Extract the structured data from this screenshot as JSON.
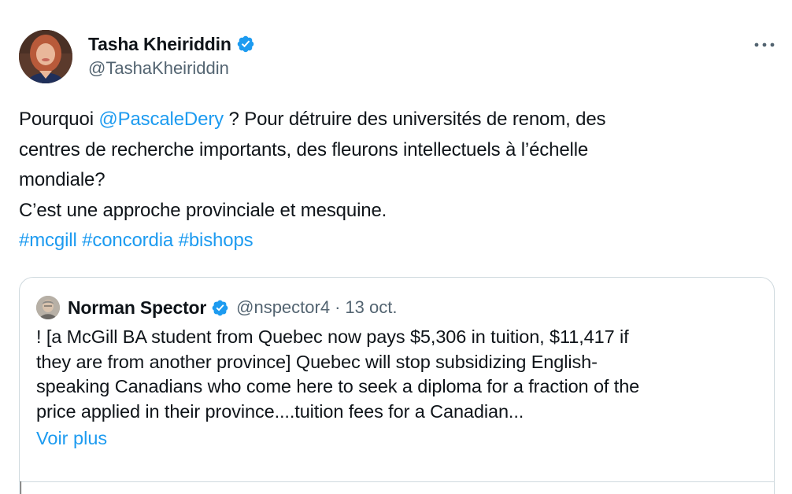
{
  "tweet": {
    "author": {
      "name": "Tasha Kheiriddin",
      "handle": "@TashaKheiriddin",
      "verified": true,
      "avatar_icon": "profile-photo"
    },
    "more_icon": "more-horizontal-icon",
    "text": {
      "line1_prefix": "Pourquoi ",
      "mention": "@PascaleDery",
      "line1_suffix": " ? Pour détruire des universités de renom, des",
      "line2": "centres de recherche importants, des fleurons intellectuels à l’échelle",
      "line3": "mondiale?",
      "line4": "C’est une approche provinciale et mesquine.",
      "hashtags": [
        "#mcgill",
        "#concordia",
        "#bishops"
      ]
    }
  },
  "quote": {
    "author": {
      "name": "Norman Spector",
      "handle": "@nspector4",
      "verified": true
    },
    "separator": "·",
    "date": "13 oct.",
    "lines": [
      "! [a McGill BA student from Quebec now pays $5,306 in tuition, $11,417 if",
      "they are from another province] Quebec will stop subsidizing  English-",
      "speaking Canadians who come here to seek a diploma for a fraction of the",
      "price applied in their province....tuition fees for a Canadian..."
    ],
    "more_label": "Voir plus"
  },
  "colors": {
    "link": "#1d9bf0",
    "verified": "#1d9bf0",
    "secondary_text": "#536471",
    "border": "#cfd9de"
  }
}
